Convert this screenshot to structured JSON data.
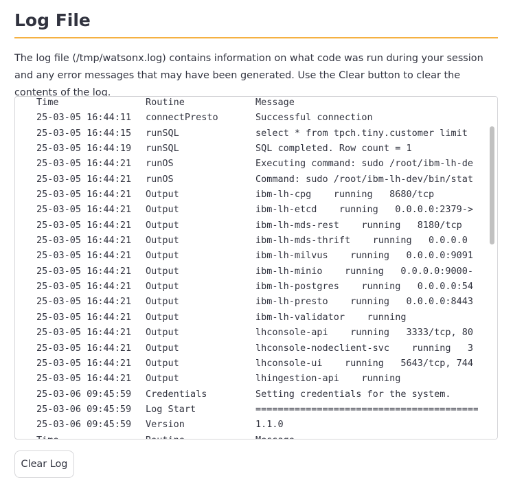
{
  "page": {
    "title": "Log File",
    "description": "The log file (/tmp/watsonx.log) contains information on what code was run during your session and any error messages that may have been generated. Use the Clear button to clear the contents of the log."
  },
  "log": {
    "rows": [
      {
        "time": "Time",
        "routine": "Routine",
        "message": "Message"
      },
      {
        "time": "25-03-05 16:44:11",
        "routine": "connectPresto",
        "message": "Successful connection"
      },
      {
        "time": "25-03-05 16:44:15",
        "routine": "runSQL",
        "message": "select * from tpch.tiny.customer limit"
      },
      {
        "time": "25-03-05 16:44:19",
        "routine": "runSQL",
        "message": "SQL completed. Row count = 1"
      },
      {
        "time": "25-03-05 16:44:21",
        "routine": "runOS",
        "message": "Executing command: sudo /root/ibm-lh-de"
      },
      {
        "time": "25-03-05 16:44:21",
        "routine": "runOS",
        "message": "Command: sudo /root/ibm-lh-dev/bin/stat"
      },
      {
        "time": "25-03-05 16:44:21",
        "routine": "Output",
        "message": "ibm-lh-cpg    running   8680/tcp"
      },
      {
        "time": "25-03-05 16:44:21",
        "routine": "Output",
        "message": "ibm-lh-etcd    running   0.0.0.0:2379->"
      },
      {
        "time": "25-03-05 16:44:21",
        "routine": "Output",
        "message": "ibm-lh-mds-rest    running   8180/tcp"
      },
      {
        "time": "25-03-05 16:44:21",
        "routine": "Output",
        "message": "ibm-lh-mds-thrift    running   0.0.0.0"
      },
      {
        "time": "25-03-05 16:44:21",
        "routine": "Output",
        "message": "ibm-lh-milvus    running   0.0.0.0:9091"
      },
      {
        "time": "25-03-05 16:44:21",
        "routine": "Output",
        "message": "ibm-lh-minio    running   0.0.0.0:9000-"
      },
      {
        "time": "25-03-05 16:44:21",
        "routine": "Output",
        "message": "ibm-lh-postgres    running   0.0.0.0:54"
      },
      {
        "time": "25-03-05 16:44:21",
        "routine": "Output",
        "message": "ibm-lh-presto    running   0.0.0.0:8443"
      },
      {
        "time": "25-03-05 16:44:21",
        "routine": "Output",
        "message": "ibm-lh-validator    running"
      },
      {
        "time": "25-03-05 16:44:21",
        "routine": "Output",
        "message": "lhconsole-api    running   3333/tcp, 80"
      },
      {
        "time": "25-03-05 16:44:21",
        "routine": "Output",
        "message": "lhconsole-nodeclient-svc    running   3"
      },
      {
        "time": "25-03-05 16:44:21",
        "routine": "Output",
        "message": "lhconsole-ui    running   5643/tcp, 744"
      },
      {
        "time": "25-03-05 16:44:21",
        "routine": "Output",
        "message": "lhingestion-api    running"
      },
      {
        "time": "25-03-06 09:45:59",
        "routine": "Credentials",
        "message": "Setting credentials for the system."
      },
      {
        "time": "25-03-06 09:45:59",
        "routine": "Log Start",
        "message": "========================================"
      },
      {
        "time": "25-03-06 09:45:59",
        "routine": "Version",
        "message": "1.1.0"
      },
      {
        "time": "Time",
        "routine": "Routine",
        "message": "Message"
      }
    ]
  },
  "actions": {
    "clear_label": "Clear Log"
  }
}
